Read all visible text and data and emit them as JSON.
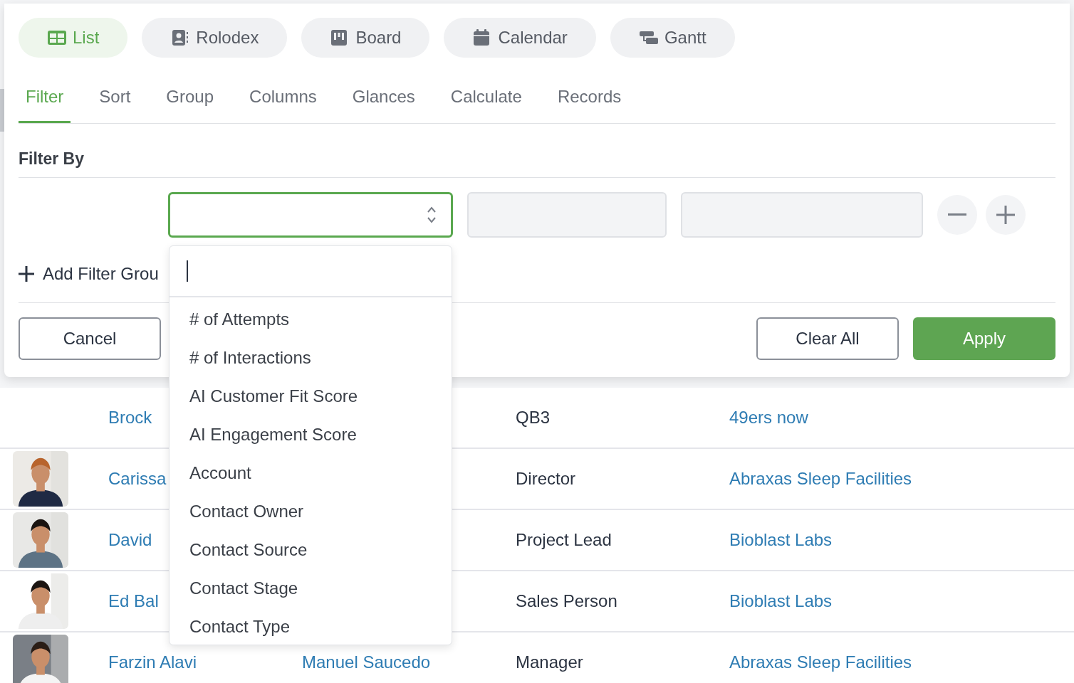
{
  "view_tabs": [
    {
      "kind": "list",
      "label": "List",
      "selected": true
    },
    {
      "kind": "rolodex",
      "label": "Rolodex",
      "selected": false
    },
    {
      "kind": "board",
      "label": "Board",
      "selected": false
    },
    {
      "kind": "calendar",
      "label": "Calendar",
      "selected": false
    },
    {
      "kind": "gantt",
      "label": "Gantt",
      "selected": false
    }
  ],
  "filter_tabs": [
    {
      "label": "Filter",
      "selected": true
    },
    {
      "label": "Sort",
      "selected": false
    },
    {
      "label": "Group",
      "selected": false
    },
    {
      "label": "Columns",
      "selected": false
    },
    {
      "label": "Glances",
      "selected": false
    },
    {
      "label": "Calculate",
      "selected": false
    },
    {
      "label": "Records",
      "selected": false
    }
  ],
  "filter": {
    "title": "Filter By",
    "add_group": "Add Filter Grou"
  },
  "buttons": {
    "cancel": "Cancel",
    "clear_all": "Clear All",
    "apply": "Apply"
  },
  "dropdown": {
    "items": [
      "# of Attempts",
      "# of Interactions",
      "AI Customer Fit Score",
      "AI Engagement Score",
      "Account",
      "Contact Owner",
      "Contact Source",
      "Contact Stage",
      "Contact Type"
    ]
  },
  "rows": [
    {
      "avatar": false,
      "name": "Brock",
      "title": "QB3",
      "company": "49ers now"
    },
    {
      "avatar": true,
      "name": "Carissa",
      "title": "Director",
      "company": "Abraxas Sleep Facilities"
    },
    {
      "avatar": true,
      "name": "David",
      "title": "Project Lead",
      "company": "Bioblast Labs"
    },
    {
      "avatar": true,
      "name": "Ed Bal",
      "title": "Sales Person",
      "company": "Bioblast Labs"
    },
    {
      "avatar": true,
      "name": "Farzin Alavi",
      "column_2": "Manuel Saucedo",
      "title": "Manager",
      "company": "Abraxas Sleep Facilities"
    }
  ]
}
